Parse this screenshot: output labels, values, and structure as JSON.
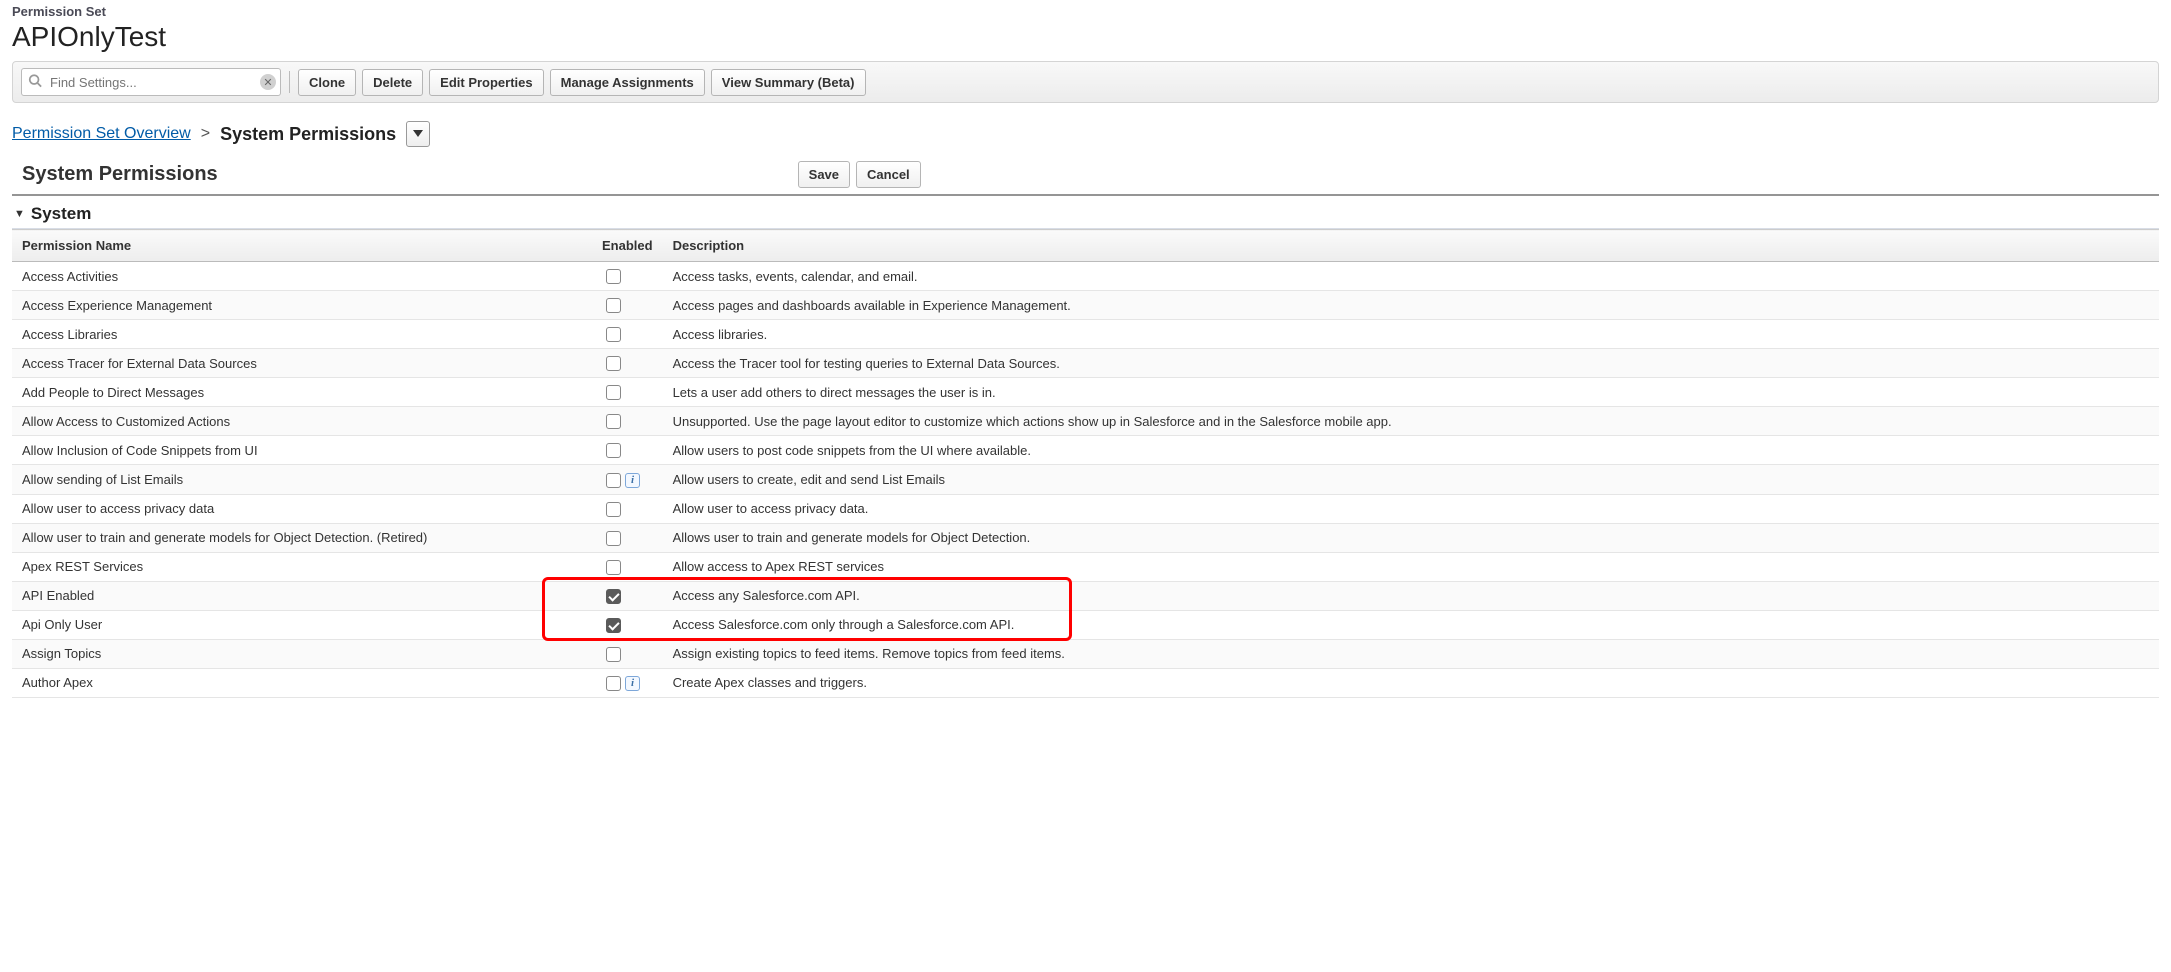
{
  "header": {
    "label": "Permission Set",
    "title": "APIOnlyTest"
  },
  "search": {
    "placeholder": "Find Settings..."
  },
  "toolbar": {
    "clone": "Clone",
    "delete": "Delete",
    "edit_properties": "Edit Properties",
    "manage_assignments": "Manage Assignments",
    "view_summary": "View Summary (Beta)"
  },
  "breadcrumb": {
    "overview": "Permission Set Overview",
    "sep": ">",
    "current": "System Permissions"
  },
  "section": {
    "title": "System Permissions",
    "save": "Save",
    "cancel": "Cancel"
  },
  "group": {
    "label": "System"
  },
  "columns": {
    "name": "Permission Name",
    "enabled": "Enabled",
    "description": "Description"
  },
  "rows": [
    {
      "name": "Access Activities",
      "enabled": false,
      "info": false,
      "desc": "Access tasks, events, calendar, and email."
    },
    {
      "name": "Access Experience Management",
      "enabled": false,
      "info": false,
      "desc": "Access pages and dashboards available in Experience Management."
    },
    {
      "name": "Access Libraries",
      "enabled": false,
      "info": false,
      "desc": "Access libraries."
    },
    {
      "name": "Access Tracer for External Data Sources",
      "enabled": false,
      "info": false,
      "desc": "Access the Tracer tool for testing queries to External Data Sources."
    },
    {
      "name": "Add People to Direct Messages",
      "enabled": false,
      "info": false,
      "desc": "Lets a user add others to direct messages the user is in."
    },
    {
      "name": "Allow Access to Customized Actions",
      "enabled": false,
      "info": false,
      "desc": "Unsupported. Use the page layout editor to customize which actions show up in Salesforce and in the Salesforce mobile app."
    },
    {
      "name": "Allow Inclusion of Code Snippets from UI",
      "enabled": false,
      "info": false,
      "desc": "Allow users to post code snippets from the UI where available."
    },
    {
      "name": "Allow sending of List Emails",
      "enabled": false,
      "info": true,
      "desc": "Allow users to create, edit and send List Emails"
    },
    {
      "name": "Allow user to access privacy data",
      "enabled": false,
      "info": false,
      "desc": "Allow user to access privacy data."
    },
    {
      "name": "Allow user to train and generate models for Object Detection. (Retired)",
      "enabled": false,
      "info": false,
      "desc": "Allows user to train and generate models for Object Detection."
    },
    {
      "name": "Apex REST Services",
      "enabled": false,
      "info": false,
      "desc": "Allow access to Apex REST services"
    },
    {
      "name": "API Enabled",
      "enabled": true,
      "info": false,
      "desc": "Access any Salesforce.com API."
    },
    {
      "name": "Api Only User",
      "enabled": true,
      "info": false,
      "desc": "Access Salesforce.com only through a Salesforce.com API."
    },
    {
      "name": "Assign Topics",
      "enabled": false,
      "info": false,
      "desc": "Assign existing topics to feed items. Remove topics from feed items."
    },
    {
      "name": "Author Apex",
      "enabled": false,
      "info": true,
      "desc": "Create Apex classes and triggers."
    }
  ]
}
